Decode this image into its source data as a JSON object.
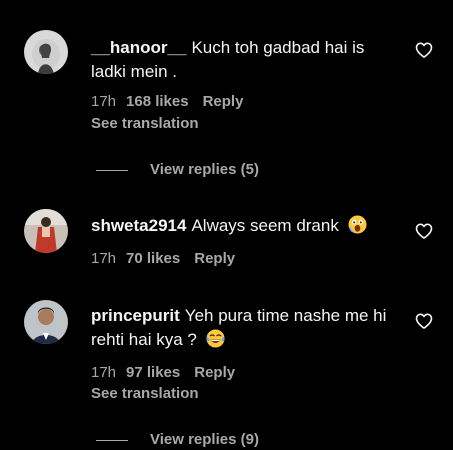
{
  "comments": [
    {
      "username": "__hanoor__",
      "text": "Kuch toh gadbad hai is ladki mein .",
      "time": "17h",
      "likes": "168 likes",
      "reply": "Reply",
      "see_translation": "See translation",
      "view_replies": "View replies (5)"
    },
    {
      "username": "shweta2914",
      "text": "Always seem drank",
      "emoji": "face-screaming-emoji",
      "time": "17h",
      "likes": "70 likes",
      "reply": "Reply"
    },
    {
      "username": "princepurit",
      "text": "Yeh pura time nashe me hi rehti hai kya ?",
      "emoji": "face-with-tears-of-joy-emoji",
      "time": "17h",
      "likes": "97 likes",
      "reply": "Reply",
      "see_translation": "See translation",
      "view_replies": "View replies (9)"
    }
  ],
  "colors": {
    "background": "#000000",
    "text_primary": "#f5f5f5",
    "text_secondary": "#a8a8a8"
  },
  "icons": {
    "like": "heart-outline-icon"
  }
}
